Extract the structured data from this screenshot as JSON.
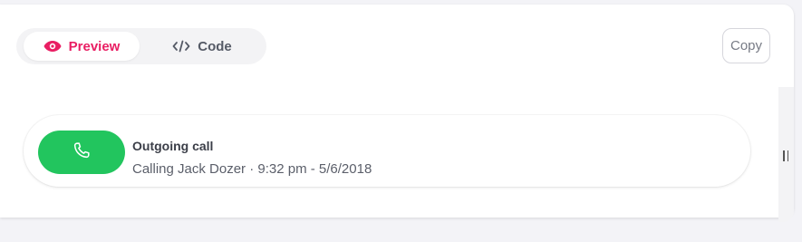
{
  "tabs": {
    "preview_label": "Preview",
    "code_label": "Code",
    "preview_icon": "eye-icon",
    "code_icon": "code-icon",
    "active": "Preview"
  },
  "toolbar": {
    "copy_label": "Copy"
  },
  "notification": {
    "icon": "phone-icon",
    "title": "Outgoing call",
    "subtitle": "Calling Jack Dozer · 9:32 pm - 5/6/2018"
  },
  "colors": {
    "accent": "#e91e63",
    "call_green": "#22c55e",
    "background": "#f3f3f7"
  }
}
